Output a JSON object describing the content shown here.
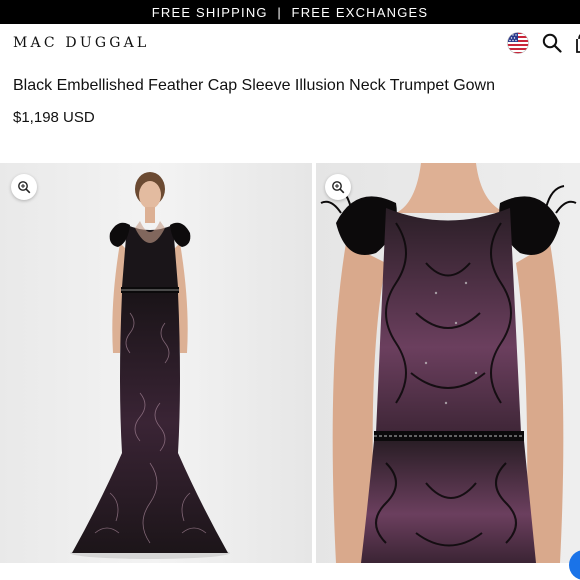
{
  "promo": {
    "text": "FREE SHIPPING  |  FREE EXCHANGES"
  },
  "header": {
    "logo": "MAC DUGGAL",
    "icons": [
      "us-flag-icon",
      "search-icon",
      "shopping-bag-icon"
    ]
  },
  "product": {
    "title": "Black Embellished Feather Cap Sleeve Illusion Neck Trumpet Gown",
    "price": "$1,198 USD"
  },
  "gallery": {
    "images": [
      "full-length-gown-photo",
      "bodice-closeup-photo"
    ],
    "zoom_icon": "zoom-in-icon"
  },
  "colors": {
    "promo_bg": "#000000",
    "accent_chat": "#1a73e8",
    "gown_black": "#111111",
    "gown_lining": "#6b3f5e"
  }
}
